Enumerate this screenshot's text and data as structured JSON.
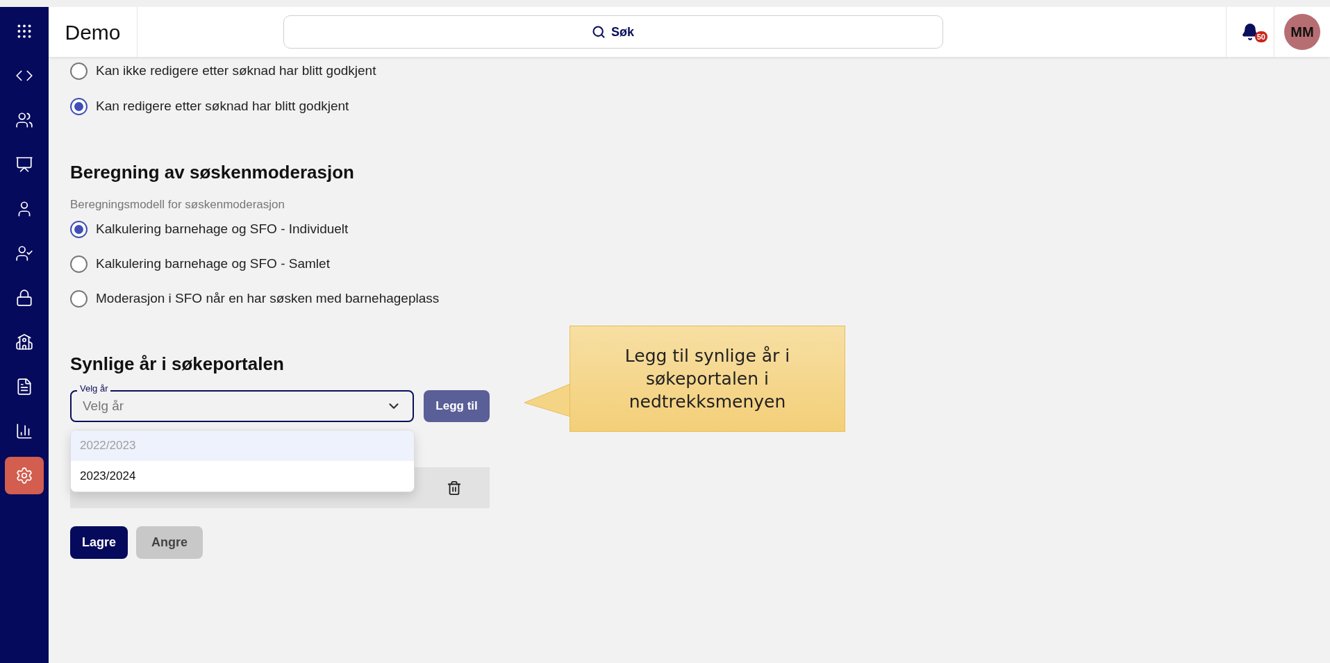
{
  "sidebar": {
    "items": [
      {
        "kind": "apps",
        "selected": false
      },
      {
        "kind": "code",
        "selected": false
      },
      {
        "kind": "group",
        "selected": false
      },
      {
        "kind": "board",
        "selected": false
      },
      {
        "kind": "user",
        "selected": false
      },
      {
        "kind": "user-check",
        "selected": false
      },
      {
        "kind": "lock",
        "selected": false
      },
      {
        "kind": "desk",
        "selected": false
      },
      {
        "kind": "document",
        "selected": false
      },
      {
        "kind": "chart",
        "selected": false
      },
      {
        "kind": "settings",
        "selected": true
      }
    ]
  },
  "header": {
    "title": "Demo",
    "search": {
      "placeholder": "Søk"
    },
    "notifications": {
      "count": "50"
    },
    "avatar": {
      "initials": "MM"
    }
  },
  "edit_section": {
    "options": [
      {
        "label": "Kan ikke redigere etter søknad har blitt godkjent",
        "selected": false
      },
      {
        "label": "Kan redigere etter søknad har blitt godkjent",
        "selected": true
      }
    ]
  },
  "sibling_section": {
    "heading": "Beregning av søskenmoderasjon",
    "subtitle": "Beregningsmodell for søskenmoderasjon",
    "options": [
      {
        "label": "Kalkulering barnehage og SFO - Individuelt",
        "selected": true
      },
      {
        "label": "Kalkulering barnehage og SFO - Samlet",
        "selected": false
      },
      {
        "label": "Moderasjon i SFO når en har søsken med barnehageplass",
        "selected": false
      }
    ]
  },
  "years_section": {
    "heading": "Synlige år i søkeportalen",
    "select": {
      "label": "Velg år",
      "placeholder": "Velg år",
      "expanded": true
    },
    "add_button": "Legg til",
    "dropdown_options": [
      {
        "label": "2022/2023",
        "disabled": true
      },
      {
        "label": "2023/2024",
        "disabled": false
      }
    ]
  },
  "actions": {
    "save": {
      "label": "Lagre",
      "disabled": false
    },
    "cancel": {
      "label": "Angre",
      "disabled": true
    }
  },
  "tooltip": {
    "text": "Legg til synlige år i søkeportalen i nedtrekksmenyen"
  }
}
